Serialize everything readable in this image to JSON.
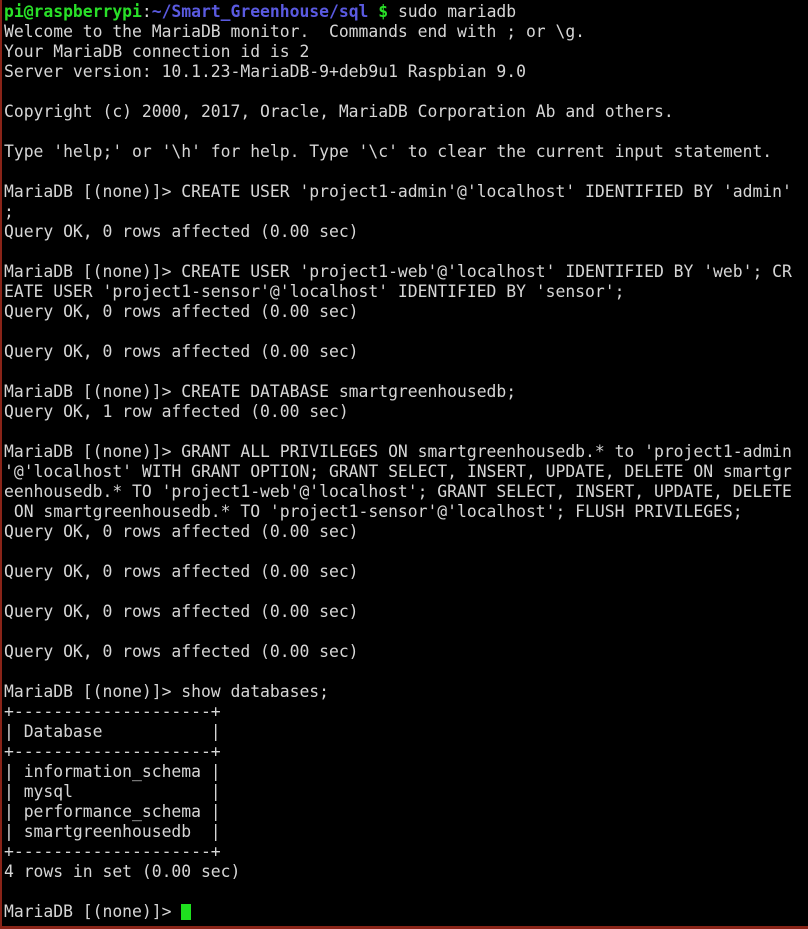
{
  "terminal": {
    "window_title": "pi@raspberrypi: ~/Smart_Greenhouse/sql",
    "shell_prompt": {
      "user_host": "pi@raspberrypi",
      "separator": ":",
      "path": "~/Smart_Greenhouse/sql",
      "dollar": "$",
      "command": " sudo mariadb"
    },
    "colors": {
      "background": "#000000",
      "foreground": "#d6d6d6",
      "prompt_user": "#29e028",
      "prompt_path": "#5a5ae0",
      "cursor": "#1fe01f",
      "window_border": "#8a2418"
    },
    "cursor": {
      "visible": true,
      "shape": "block"
    },
    "lines": [
      "Welcome to the MariaDB monitor.  Commands end with ; or \\g.",
      "Your MariaDB connection id is 2",
      "Server version: 10.1.23-MariaDB-9+deb9u1 Raspbian 9.0",
      "",
      "Copyright (c) 2000, 2017, Oracle, MariaDB Corporation Ab and others.",
      "",
      "Type 'help;' or '\\h' for help. Type '\\c' to clear the current input statement.",
      "",
      "MariaDB [(none)]> CREATE USER 'project1-admin'@'localhost' IDENTIFIED BY 'admin'",
      ";",
      "Query OK, 0 rows affected (0.00 sec)",
      "",
      "MariaDB [(none)]> CREATE USER 'project1-web'@'localhost' IDENTIFIED BY 'web'; CR",
      "EATE USER 'project1-sensor'@'localhost' IDENTIFIED BY 'sensor';",
      "Query OK, 0 rows affected (0.00 sec)",
      "",
      "Query OK, 0 rows affected (0.00 sec)",
      "",
      "MariaDB [(none)]> CREATE DATABASE smartgreenhousedb;",
      "Query OK, 1 row affected (0.00 sec)",
      "",
      "MariaDB [(none)]> GRANT ALL PRIVILEGES ON smartgreenhousedb.* to 'project1-admin",
      "'@'localhost' WITH GRANT OPTION; GRANT SELECT, INSERT, UPDATE, DELETE ON smartgr",
      "eenhousedb.* TO 'project1-web'@'localhost'; GRANT SELECT, INSERT, UPDATE, DELETE",
      " ON smartgreenhousedb.* TO 'project1-sensor'@'localhost'; FLUSH PRIVILEGES;",
      "Query OK, 0 rows affected (0.00 sec)",
      "",
      "Query OK, 0 rows affected (0.00 sec)",
      "",
      "Query OK, 0 rows affected (0.00 sec)",
      "",
      "Query OK, 0 rows affected (0.00 sec)",
      "",
      "MariaDB [(none)]> show databases;",
      "+--------------------+",
      "| Database           |",
      "+--------------------+",
      "| information_schema |",
      "| mysql              |",
      "| performance_schema |",
      "| smartgreenhousedb  |",
      "+--------------------+",
      "4 rows in set (0.00 sec)",
      ""
    ],
    "final_prompt": "MariaDB [(none)]> ",
    "databases_table": {
      "header": "Database",
      "rows": [
        "information_schema",
        "mysql",
        "performance_schema",
        "smartgreenhousedb"
      ],
      "row_count_text": "4 rows in set (0.00 sec)"
    }
  }
}
